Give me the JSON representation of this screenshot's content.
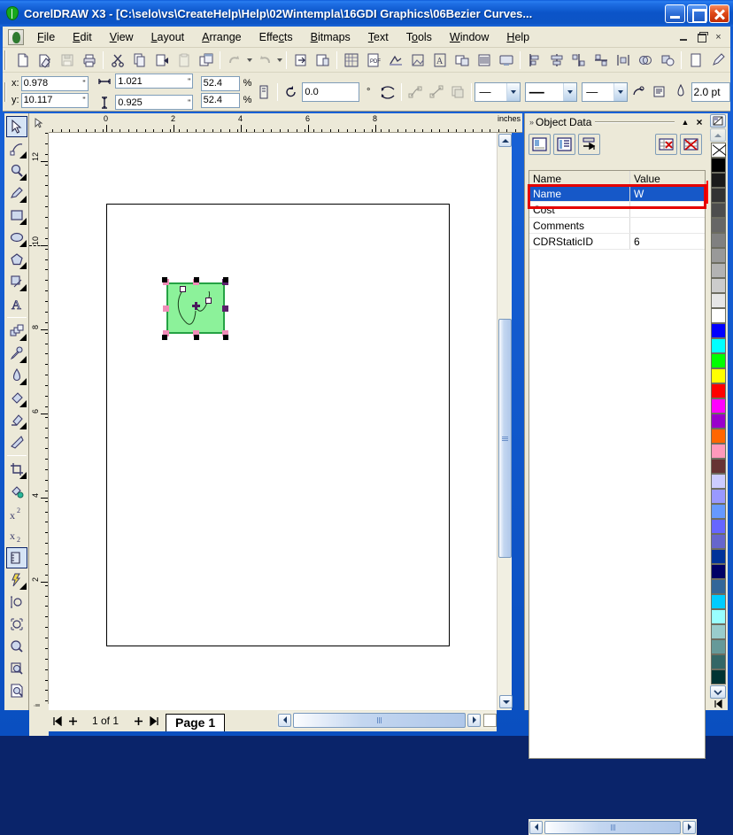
{
  "window": {
    "title": "CorelDRAW X3 - [C:\\selo\\vs\\CreateHelp\\Help\\02Wintempla\\16GDI Graphics\\06Bezier Curves...",
    "app_icon": "coreldraw-balloon-icon",
    "caption_buttons": [
      {
        "name": "minimize-button",
        "label": ""
      },
      {
        "name": "maximize-button",
        "label": ""
      },
      {
        "name": "close-button",
        "label": ""
      }
    ]
  },
  "menu": {
    "doc_icon": "document-control-icon",
    "items": [
      {
        "label": "File",
        "accel": "F"
      },
      {
        "label": "Edit",
        "accel": "E"
      },
      {
        "label": "View",
        "accel": "V"
      },
      {
        "label": "Layout",
        "accel": "L"
      },
      {
        "label": "Arrange",
        "accel": "A"
      },
      {
        "label": "Effects",
        "accel": "c"
      },
      {
        "label": "Bitmaps",
        "accel": "B"
      },
      {
        "label": "Text",
        "accel": "T"
      },
      {
        "label": "Tools",
        "accel": "o"
      },
      {
        "label": "Window",
        "accel": "W"
      },
      {
        "label": "Help",
        "accel": "H"
      }
    ],
    "mdi": [
      {
        "name": "mdi-minimize-button",
        "label": "–"
      },
      {
        "name": "mdi-restore-button",
        "label": ""
      },
      {
        "name": "mdi-close-button",
        "label": "×"
      }
    ]
  },
  "standard_toolbar": {
    "items": [
      {
        "name": "new-button",
        "icon": "new-document-icon",
        "enabled": true
      },
      {
        "name": "open-button",
        "icon": "open-folder-icon",
        "enabled": true
      },
      {
        "name": "save-button",
        "icon": "floppy-disk-icon",
        "enabled": false
      },
      {
        "name": "print-button",
        "icon": "printer-icon",
        "enabled": true
      },
      {
        "name": "cut-button",
        "icon": "scissors-icon",
        "enabled": true
      },
      {
        "name": "copy-button",
        "icon": "copy-pages-icon",
        "enabled": true
      },
      {
        "name": "paste-special-button",
        "icon": "paste-arrow-icon",
        "enabled": true
      },
      {
        "name": "paste-button",
        "icon": "clipboard-icon",
        "enabled": false
      },
      {
        "name": "duplicate-button",
        "icon": "duplicate-windows-icon",
        "enabled": true
      },
      {
        "name": "undo-button",
        "icon": "undo-arrow-icon",
        "enabled": false
      },
      {
        "name": "redo-button",
        "icon": "redo-arrow-icon",
        "enabled": false
      },
      {
        "name": "import-button",
        "icon": "import-icon",
        "enabled": true
      },
      {
        "name": "export-button",
        "icon": "export-icon",
        "enabled": true
      },
      {
        "name": "application-launcher-button",
        "icon": "app-launcher-icon",
        "enabled": true
      },
      {
        "name": "pdf-button",
        "icon": "pdf-icon",
        "enabled": true
      },
      {
        "name": "corel-trace-button",
        "icon": "trace-icon",
        "enabled": true
      },
      {
        "name": "photo-paint-button",
        "icon": "photo-paint-icon",
        "enabled": true
      },
      {
        "name": "font-navigator-button",
        "icon": "font-navigator-icon",
        "enabled": true
      },
      {
        "name": "capture-button",
        "icon": "capture-icon",
        "enabled": true
      },
      {
        "name": "barcode-button",
        "icon": "barcode-icon",
        "enabled": true
      },
      {
        "name": "screen-button",
        "icon": "screen-icon",
        "enabled": true
      },
      {
        "name": "align-left-button",
        "icon": "align-left-icon",
        "enabled": true
      },
      {
        "name": "align-center-h-button",
        "icon": "align-center-icon",
        "enabled": true
      },
      {
        "name": "align-right-button",
        "icon": "align-right-icon",
        "enabled": true
      },
      {
        "name": "align-top-button",
        "icon": "align-top-icon",
        "enabled": true
      },
      {
        "name": "distribute-button",
        "icon": "distribute-icon",
        "enabled": true
      },
      {
        "name": "weld-button",
        "icon": "weld-icon",
        "enabled": true
      },
      {
        "name": "trim-button",
        "icon": "trim-icon",
        "enabled": true
      },
      {
        "name": "page-setup-button",
        "icon": "page-setup-icon",
        "enabled": true
      },
      {
        "name": "outline-pen-button",
        "icon": "outline-pen-icon",
        "enabled": true
      },
      {
        "name": "outline-color-button",
        "icon": "outline-color-icon",
        "enabled": true
      },
      {
        "name": "fill-dialog-button",
        "icon": "fill-dialog-icon",
        "enabled": true
      },
      {
        "name": "color-table-button",
        "icon": "color-table-icon",
        "enabled": true
      },
      {
        "name": "color-palette-button",
        "icon": "color-palette-icon",
        "enabled": true
      }
    ]
  },
  "property_bar": {
    "x_label": "x:",
    "y_label": "y:",
    "x_value": "0.978",
    "y_value": "10.117",
    "unit_symbol": "\"",
    "width_icon": "width-arrows-icon",
    "height_icon": "height-arrows-icon",
    "width_value": "1.021",
    "height_value": "0.925",
    "scale_h_value": "52.4",
    "scale_v_value": "52.4",
    "percent_symbol": "%",
    "lock_ratio_icon": "lock-ratio-icon",
    "rotate_icon": "rotate-icon",
    "angle_value": "0.0",
    "degree_symbol": "°",
    "mirror_icon": "mirror-horizontal-icon",
    "to_curves_icon": "convert-to-curves-icon",
    "outline_icon": "convert-outline-icon",
    "wrap_icon": "wrap-paragraph-icon",
    "start_arrow": "—",
    "line_style": "—",
    "end_arrow": "—",
    "contour_icon": "contour-icon",
    "text_wrap_icon": "text-wrap-icon",
    "pen_icon": "outline-width-pen-icon",
    "outline_width": "2.0 pt"
  },
  "rulers": {
    "unit_label": "inches",
    "vertical_unit_label": "inches",
    "h_ticks": [
      "0",
      "2",
      "4",
      "6",
      "8"
    ],
    "v_ticks": [
      "12",
      "10",
      "8",
      "6",
      "4",
      "2"
    ]
  },
  "toolbox": {
    "tools": [
      {
        "name": "pick-tool",
        "icon": "arrow-cursor-icon",
        "selected": true,
        "flyout": false
      },
      {
        "name": "shape-tool",
        "icon": "shape-node-icon",
        "selected": false,
        "flyout": true
      },
      {
        "name": "zoom-tool",
        "icon": "magnifier-icon",
        "selected": false,
        "flyout": true
      },
      {
        "name": "freehand-tool",
        "icon": "pencil-icon",
        "selected": false,
        "flyout": true
      },
      {
        "name": "rectangle-tool",
        "icon": "rectangle-icon",
        "selected": false,
        "flyout": true
      },
      {
        "name": "ellipse-tool",
        "icon": "ellipse-icon",
        "selected": false,
        "flyout": true
      },
      {
        "name": "polygon-tool",
        "icon": "polygon-icon",
        "selected": false,
        "flyout": true
      },
      {
        "name": "perfect-shapes-tool",
        "icon": "perfect-shapes-icon",
        "selected": false,
        "flyout": true
      },
      {
        "name": "text-tool",
        "icon": "text-a-icon",
        "selected": false,
        "flyout": false
      },
      {
        "name": "blend-tool",
        "icon": "interactive-blend-icon",
        "selected": false,
        "flyout": true
      },
      {
        "name": "eyedropper-tool",
        "icon": "eyedropper-icon",
        "selected": false,
        "flyout": true
      },
      {
        "name": "outline-tool",
        "icon": "outline-pen-nib-icon",
        "selected": false,
        "flyout": true
      },
      {
        "name": "fill-tool",
        "icon": "paint-bucket-icon",
        "selected": false,
        "flyout": true
      },
      {
        "name": "interactive-fill-tool",
        "icon": "interactive-fill-icon",
        "selected": false,
        "flyout": true
      },
      {
        "name": "mesh-fill-tool",
        "icon": "mesh-fill-icon",
        "selected": false,
        "flyout": false
      },
      {
        "name": "crop-tool",
        "icon": "crop-icon",
        "selected": false,
        "flyout": true
      },
      {
        "name": "smart-fill-tool",
        "icon": "smart-fill-icon",
        "selected": false,
        "flyout": false
      },
      {
        "name": "superscript-tool",
        "icon": "superscript-icon",
        "selected": false,
        "flyout": false
      },
      {
        "name": "subscript-tool",
        "icon": "subscript-icon",
        "selected": false,
        "flyout": false
      },
      {
        "name": "dimension-tool",
        "icon": "ruler-dimension-icon",
        "selected": true,
        "flyout": false
      },
      {
        "name": "smart-drawing-tool",
        "icon": "smart-drawing-icon",
        "selected": false,
        "flyout": true
      },
      {
        "name": "zoom-height-tool",
        "icon": "zoom-height-icon",
        "selected": false,
        "flyout": false
      },
      {
        "name": "zoom-selection-tool",
        "icon": "zoom-selection-icon",
        "selected": false,
        "flyout": false
      },
      {
        "name": "zoom-all-objects-tool",
        "icon": "zoom-all-objects-icon",
        "selected": false,
        "flyout": false
      },
      {
        "name": "zoom-page-tool",
        "icon": "zoom-page-icon",
        "selected": false,
        "flyout": false
      },
      {
        "name": "zoom-page-width-tool",
        "icon": "zoom-page-width-icon",
        "selected": false,
        "flyout": false
      }
    ]
  },
  "canvas": {
    "object": {
      "name": "selected-bezier-curve-object",
      "fill_color": "#8cf29a",
      "outline_color": "#25a244",
      "handle_color": "#000000",
      "handle_accent_color": "#f08cb8",
      "node_fill": "#ffffff"
    }
  },
  "page_navigator": {
    "first_icon": "first-page-icon",
    "add_before_icon": "add-page-icon",
    "counter": "1 of 1",
    "add_after_icon": "add-page-icon",
    "last_icon": "last-page-icon",
    "page_tab_label": "Page 1"
  },
  "docker": {
    "title": "Object Data",
    "collapse_icon": "chevron-double-right-icon",
    "roll_up_icon": "chevron-up-icon",
    "close_icon": "close-x-icon",
    "toolbar": [
      {
        "name": "open-field-editor-button",
        "icon": "field-editor-icon"
      },
      {
        "name": "open-object-data-manager-button",
        "icon": "data-manager-icon"
      },
      {
        "name": "change-summary-button",
        "icon": "summary-arrow-icon"
      },
      {
        "name": "clear-field-button",
        "icon": "clear-field-icon"
      },
      {
        "name": "clear-all-fields-button",
        "icon": "clear-all-fields-icon"
      }
    ],
    "table": {
      "columns": [
        "Name",
        "Value"
      ],
      "rows": [
        {
          "name": "Name",
          "value": "W",
          "selected": true
        },
        {
          "name": "Cost",
          "value": "",
          "selected": false
        },
        {
          "name": "Comments",
          "value": "",
          "selected": false
        },
        {
          "name": "CDRStaticID",
          "value": "6",
          "selected": false
        }
      ]
    },
    "highlight_color": "#e40000",
    "selection_color": "#1658c8"
  },
  "palette": {
    "top_icon": "palette-options-icon",
    "no_color_label": "none-swatch",
    "more_icon": "chevron-down-icon",
    "end_icon": "palette-start-icon",
    "swatches": [
      "#000000",
      "#1a1a1a",
      "#333333",
      "#4d4d4d",
      "#666666",
      "#808080",
      "#999999",
      "#b3b3b3",
      "#cccccc",
      "#e6e6e6",
      "#ffffff",
      "#0000ff",
      "#00ffff",
      "#00ff00",
      "#ffff00",
      "#ff0000",
      "#ff00ff",
      "#9900cc",
      "#ff6600",
      "#ff99bb",
      "#663333",
      "#ccccff",
      "#9999ff",
      "#6699ff",
      "#6666ff",
      "#6666cc",
      "#003399",
      "#000066",
      "#336699",
      "#00ccff",
      "#99ffff",
      "#99cccc",
      "#669999",
      "#336666",
      "#003333"
    ]
  }
}
